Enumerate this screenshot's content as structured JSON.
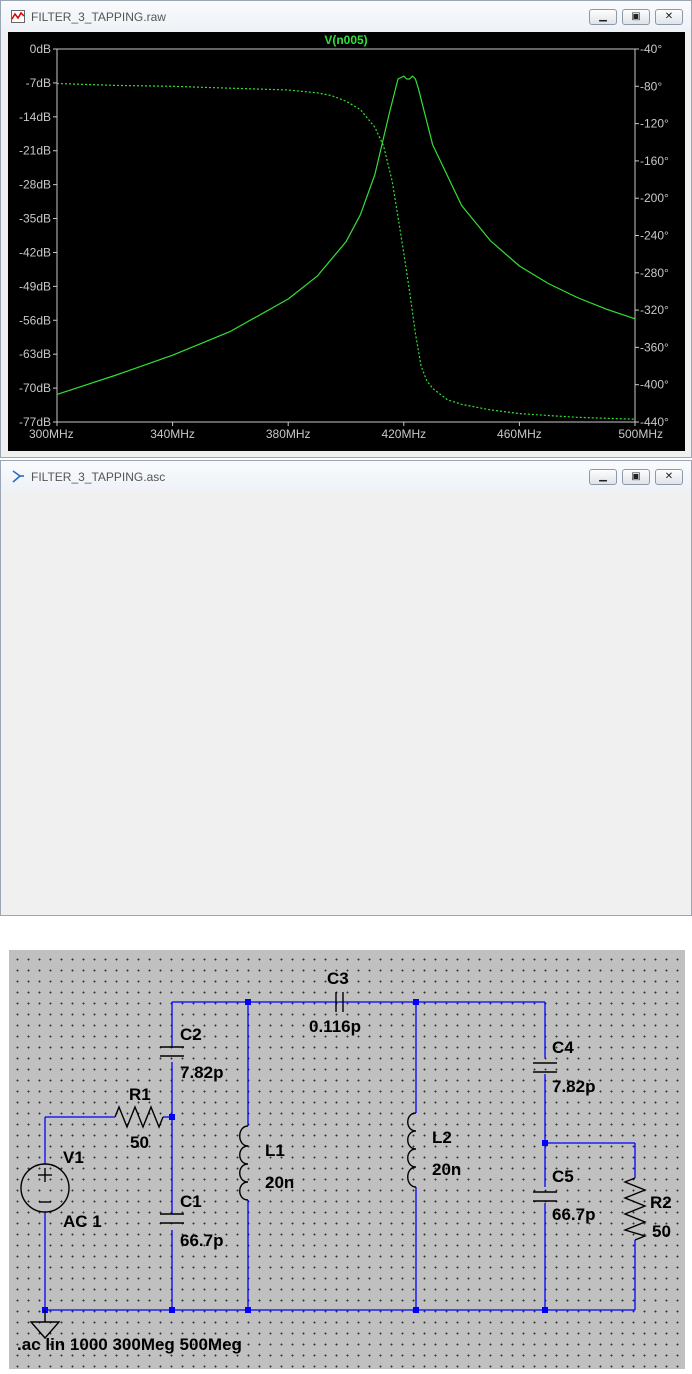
{
  "plot_window": {
    "title": "FILTER_3_TAPPING.raw",
    "buttons": {
      "minimize": "▁",
      "restore": "▣",
      "close": "✕"
    }
  },
  "schematic_window": {
    "title": "FILTER_3_TAPPING.asc",
    "buttons": {
      "minimize": "▁",
      "restore": "▣",
      "close": "✕"
    }
  },
  "chart_data": {
    "type": "line",
    "title": "V(n005)",
    "xlabel": "",
    "ylabel": "",
    "x_ticks": [
      "300MHz",
      "340MHz",
      "380MHz",
      "420MHz",
      "460MHz",
      "500MHz"
    ],
    "y_left_ticks": [
      "0dB",
      "-7dB",
      "-14dB",
      "-21dB",
      "-28dB",
      "-35dB",
      "-42dB",
      "-49dB",
      "-56dB",
      "-63dB",
      "-70dB",
      "-77dB"
    ],
    "y_right_ticks": [
      "-40°",
      "-80°",
      "-120°",
      "-160°",
      "-200°",
      "-240°",
      "-280°",
      "-320°",
      "-360°",
      "-400°",
      "-440°"
    ],
    "xlim": [
      300,
      500
    ],
    "ylim_left": [
      -77,
      0
    ],
    "ylim_right": [
      -440,
      -40
    ],
    "grid": false,
    "series": [
      {
        "name": "V(n005)",
        "style": "solid",
        "axis": "left",
        "unit": "dB",
        "x": [
          300,
          320,
          340,
          360,
          380,
          390,
          400,
          405,
          410,
          415,
          418,
          420,
          421,
          422,
          423,
          424,
          425,
          430,
          440,
          450,
          460,
          470,
          480,
          490,
          500
        ],
        "y": [
          -71.3,
          -67.4,
          -63.2,
          -58.3,
          -51.6,
          -46.9,
          -39.8,
          -34.2,
          -25.9,
          -13.3,
          -6.2,
          -5.6,
          -6.2,
          -6.2,
          -5.6,
          -6.2,
          -8.1,
          -19.8,
          -32.3,
          -39.6,
          -44.8,
          -48.4,
          -51.3,
          -53.7,
          -55.7
        ]
      },
      {
        "name": "phase",
        "style": "dashed",
        "axis": "right",
        "unit": "deg",
        "x": [
          300,
          320,
          340,
          360,
          380,
          390,
          395,
          400,
          405,
          410,
          413,
          416,
          418,
          420,
          422,
          424,
          426,
          428,
          430,
          435,
          440,
          450,
          460,
          470,
          480,
          490,
          500
        ],
        "y": [
          -77,
          -79,
          -80,
          -82,
          -84,
          -87,
          -90,
          -96,
          -105,
          -124,
          -144,
          -182,
          -220,
          -259,
          -300,
          -345,
          -380,
          -396,
          -404,
          -416,
          -421,
          -427,
          -431,
          -433,
          -435,
          -436,
          -437
        ]
      }
    ],
    "colors": {
      "trace": "#33e035",
      "axes": "#c8c8c8",
      "background": "#000000"
    }
  },
  "schematic": {
    "components": {
      "c3": {
        "name": "C3",
        "value": "0.116p"
      },
      "c2": {
        "name": "C2",
        "value": "7.82p"
      },
      "r1": {
        "name": "R1",
        "value": "50"
      },
      "l1": {
        "name": "L1",
        "value": "20n"
      },
      "l2": {
        "name": "L2",
        "value": "20n"
      },
      "c1": {
        "name": "C1",
        "value": "66.7p"
      },
      "c4": {
        "name": "C4",
        "value": "7.82p"
      },
      "c5": {
        "name": "C5",
        "value": "66.7p"
      },
      "r2": {
        "name": "R2",
        "value": "50"
      },
      "v1": {
        "name": "V1",
        "value": "AC 1"
      }
    },
    "directive": ".ac lin 1000 300Meg 500Meg",
    "colors": {
      "wire": "#0000ff",
      "component": "#000000",
      "background": "#c0c0c0"
    }
  }
}
